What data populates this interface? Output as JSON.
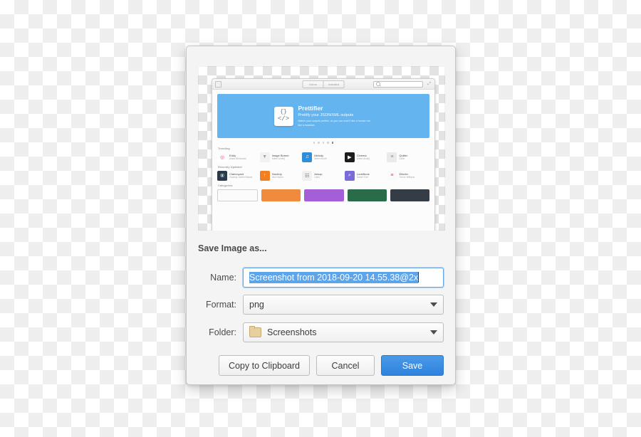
{
  "dialog": {
    "title": "Save Image as...",
    "fields": {
      "name_label": "Name:",
      "name_value": "Screenshot from 2018-09-20 14.55.38@2x",
      "format_label": "Format:",
      "format_value": "png",
      "folder_label": "Folder:",
      "folder_value": "Screenshots",
      "folder_icon": "folder-icon"
    },
    "buttons": {
      "copy": "Copy to Clipboard",
      "cancel": "Cancel",
      "save": "Save"
    },
    "colors": {
      "accent": "#3689e6",
      "selection": "#5ea4e8",
      "dialog_bg": "#f4f4f4"
    }
  },
  "preview": {
    "toolbar": {
      "back_icon": "sidebar-toggle-icon",
      "segments": [
        "Home",
        "Installed"
      ],
      "search_icon": "search-icon",
      "search_value": "",
      "expand_icon": "fullscreen-icon"
    },
    "banner": {
      "icon_line1": "{}",
      "icon_line2": "</>",
      "title": "Prettifier",
      "subtitle": "Prettify your JSON/XML outputs",
      "description": "Makes your outputs prettier, so you can read it like a human not like a machine."
    },
    "carousel": {
      "dots": 5,
      "active_index": 4
    },
    "sections": [
      {
        "label": "Trending",
        "apps": [
          {
            "name": "Eddy",
            "author": "Adam Bierkowski",
            "color": "#ffffff",
            "accent": "#e8477f",
            "glyph": "◎"
          },
          {
            "name": "Image Burner",
            "author": "Artem Anufrij",
            "color": "#f2f2f2",
            "accent": "#9aa4ad",
            "glyph": "▼"
          },
          {
            "name": "Melody",
            "author": "Artem Anufrij",
            "color": "#2e8fd8",
            "accent": "#ffffff",
            "glyph": "♫"
          },
          {
            "name": "Cinema",
            "author": "Artem Anufrij",
            "color": "#1c1c1c",
            "accent": "#ffffff",
            "glyph": "▶"
          },
          {
            "name": "Quilter",
            "author": "Lains",
            "color": "#eaeaea",
            "accent": "#8b8b8b",
            "glyph": "≡"
          }
        ]
      },
      {
        "label": "Recently Updated",
        "apps": [
          {
            "name": "Clairvoyant",
            "author": "Cassidy James Blaede",
            "color": "#2b3a4a",
            "accent": "#ffffff",
            "glyph": "⑧"
          },
          {
            "name": "HackUp",
            "author": "Med Hacila",
            "color": "#f08022",
            "accent": "#ffffff",
            "glyph": "↑"
          },
          {
            "name": "Aesop",
            "author": "Lains",
            "color": "#f0f0f0",
            "accent": "#4a4a4a",
            "glyph": "☷"
          },
          {
            "name": "LookBook",
            "author": "Daniel Foré",
            "color": "#7b6bd8",
            "accent": "#ffffff",
            "glyph": "⌕"
          },
          {
            "name": "Winder",
            "author": "Trevor Williams",
            "color": "#fafafa",
            "accent": "#d84a4a",
            "glyph": "≡"
          }
        ]
      },
      {
        "label": "Categories",
        "tiles": [
          {
            "color": "#fbfbfb",
            "outlined": true
          },
          {
            "color": "#f08a3c",
            "outlined": false
          },
          {
            "color": "#a45fd8",
            "outlined": false
          },
          {
            "color": "#2a6b4a",
            "outlined": false
          },
          {
            "color": "#343c45",
            "outlined": false
          }
        ]
      }
    ]
  }
}
